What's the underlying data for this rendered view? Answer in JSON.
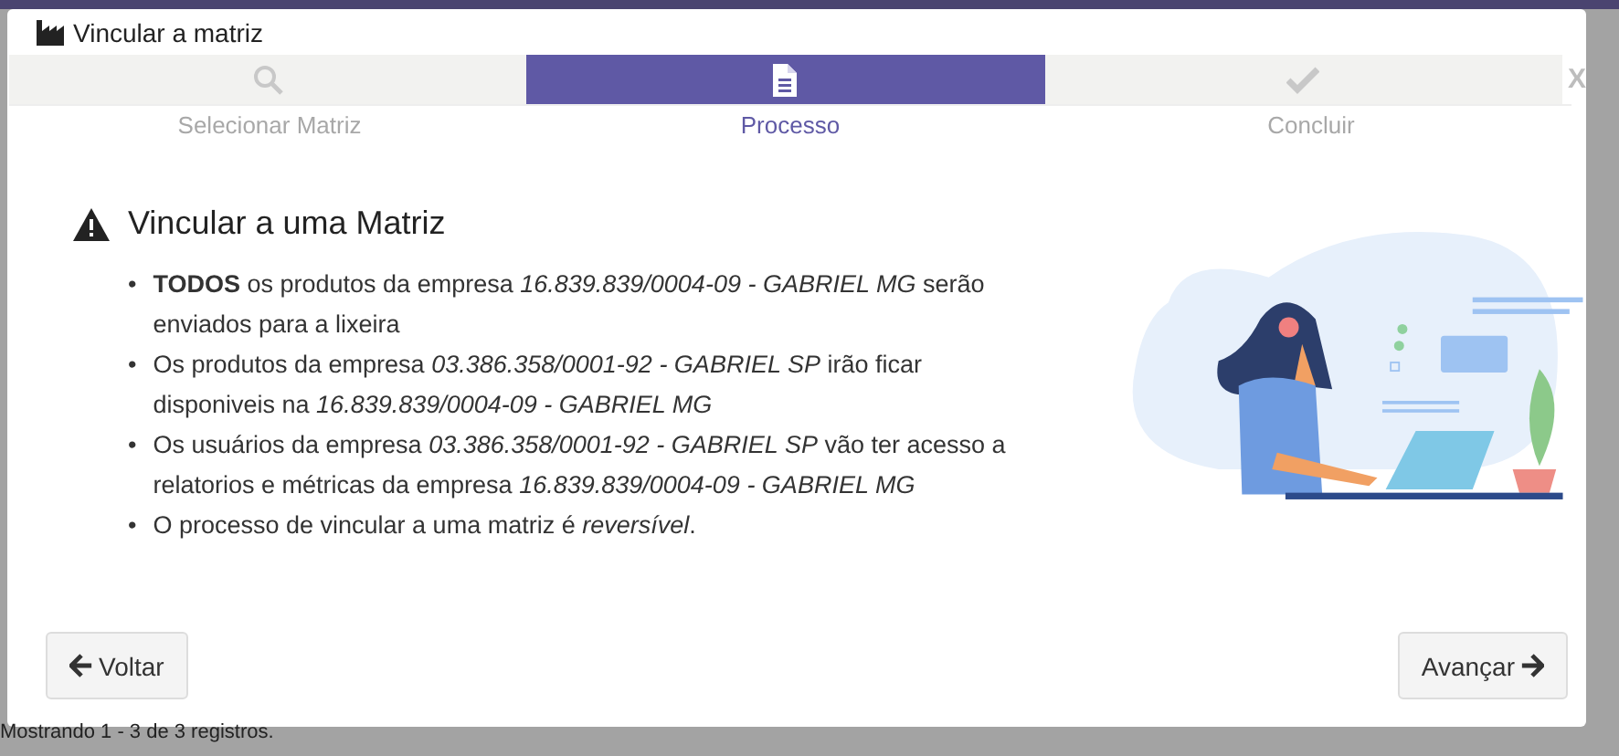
{
  "window": {
    "title": "Vincular a matriz",
    "close": "X"
  },
  "steps": [
    {
      "label": "Selecionar Matriz",
      "selected": false
    },
    {
      "label": "Processo",
      "selected": true
    },
    {
      "label": "Concluir",
      "selected": false
    }
  ],
  "heading": "Vincular a uma Matriz",
  "items": [
    {
      "marker": "•",
      "text": "**TODOS** os produtos da empresa *16.839.839/0004-09 - GABRIEL MG* serão enviados para a lixeira"
    },
    {
      "marker": "•",
      "text": "Os produtos da empresa *03.386.358/0001-92 - GABRIEL SP* irão ficar disponiveis na *16.839.839/0004-09 - GABRIEL MG*"
    },
    {
      "marker": "•",
      "text": "Os usuários da empresa *03.386.358/0001-92 - GABRIEL SP* vão ter acesso a relatorios e métricas da empresa *16.839.839/0004-09 - GABRIEL MG*"
    },
    {
      "marker": "•",
      "text": "O processo de vincular a uma matriz é *reversível*."
    }
  ],
  "buttons": [
    {
      "label": "Voltar",
      "kind": "back"
    },
    {
      "label": "Avançar",
      "kind": "next"
    }
  ],
  "background_footer": "Mostrando 1 - 3 de 3 registros."
}
